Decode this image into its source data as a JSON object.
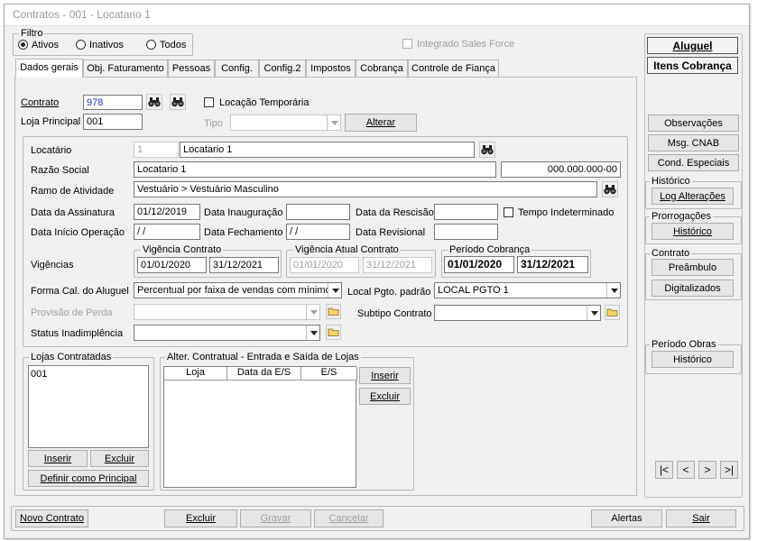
{
  "window": {
    "title": "Contratos - 001 - Locatario 1"
  },
  "filter": {
    "legend": "Filtro",
    "options": [
      "Ativos",
      "Inativos",
      "Todos"
    ],
    "selected": "Ativos",
    "integrado_label": "Integrado Sales Force"
  },
  "tabs": [
    "Dados gerais",
    "Obj. Faturamento",
    "Pessoas",
    "Config.",
    "Config.2",
    "Impostos",
    "Cobrança",
    "Controle de Fiança"
  ],
  "active_tab": "Dados gerais",
  "contract": {
    "label": "Contrato",
    "value": "978",
    "temp_label": "Locação Temporária",
    "loja_label": "Loja Principal",
    "loja_value": "001",
    "tipo_label": "Tipo",
    "tipo_value": "",
    "alterar_label": "Alterar"
  },
  "details": {
    "locatario_label": "Locatário",
    "locatario_code": "1",
    "locatario_name": "Locatario 1",
    "razao_label": "Razão Social",
    "razao_value": "Locatario 1",
    "cnpj_value": "000.000.000-00",
    "ramo_label": "Ramo de Atividade",
    "ramo_value": "Vestuário > Vestuário Masculino",
    "assinatura_label": "Data da Assinatura",
    "assinatura_value": "01/12/2019",
    "inauguracao_label": "Data Inauguração",
    "inauguracao_value": "",
    "rescisao_label": "Data da Rescisão",
    "rescisao_value": "",
    "indeterminado_label": "Tempo Indeterminado",
    "inicio_op_label": "Data Início Operação",
    "inicio_op_value": "/ /",
    "fechamento_label": "Data Fechamento",
    "fechamento_value": "/ /",
    "revisional_label": "Data Revisional",
    "revisional_value": "",
    "vigencias_label": "Vigências",
    "vig_contrato_legend": "Vigência Contrato",
    "vig_contrato_start": "01/01/2020",
    "vig_contrato_end": "31/12/2021",
    "vig_atual_legend": "Vigência Atual Contrato",
    "vig_atual_start": "01/01/2020",
    "vig_atual_end": "31/12/2021",
    "periodo_legend": "Período Cobrança",
    "periodo_start": "01/01/2020",
    "periodo_end": "31/12/2021",
    "forma_label": "Forma Cal. do Aluguel",
    "forma_value": "Percentual por faixa de vendas com mínimo",
    "local_label": "Local Pgto. padrão",
    "local_value": "LOCAL PGTO 1",
    "provisao_label": "Provisão de Perda",
    "provisao_value": "",
    "subtipo_label": "Subtipo Contrato",
    "subtipo_value": "",
    "status_label": "Status Inadimplência",
    "status_value": ""
  },
  "lojas": {
    "legend": "Lojas Contratadas",
    "items": [
      "001"
    ],
    "inserir": "Inserir",
    "excluir": "Excluir",
    "definir": "Definir como Principal"
  },
  "alter": {
    "legend": "Alter. Contratual - Entrada e Saída de Lojas",
    "columns": [
      "Loja",
      "Data da E/S",
      "E/S"
    ],
    "inserir": "Inserir",
    "excluir": "Excluir"
  },
  "right": {
    "aluguel": "Aluguel",
    "itens": "Itens Cobrança",
    "observacoes": "Observações",
    "msg_cnab": "Msg. CNAB",
    "cond_especiais": "Cond. Especiais",
    "historico_legend": "Histórico",
    "log_alteracoes": "Log Alterações",
    "prorrogacoes_legend": "Prorrogações",
    "prorrog_historico": "Histórico",
    "contrato_legend": "Contrato",
    "preambulo": "Preâmbulo",
    "digitalizados": "Digitalizados",
    "obras_legend": "Período Obras",
    "obras_historico": "Histórico",
    "nav": [
      "|<",
      "<",
      ">",
      ">|"
    ]
  },
  "bottom": {
    "novo": "Novo Contrato",
    "excluir": "Excluir",
    "gravar": "Gravar",
    "cancelar": "Cancelar",
    "alertas": "Alertas",
    "sair": "Sair"
  }
}
